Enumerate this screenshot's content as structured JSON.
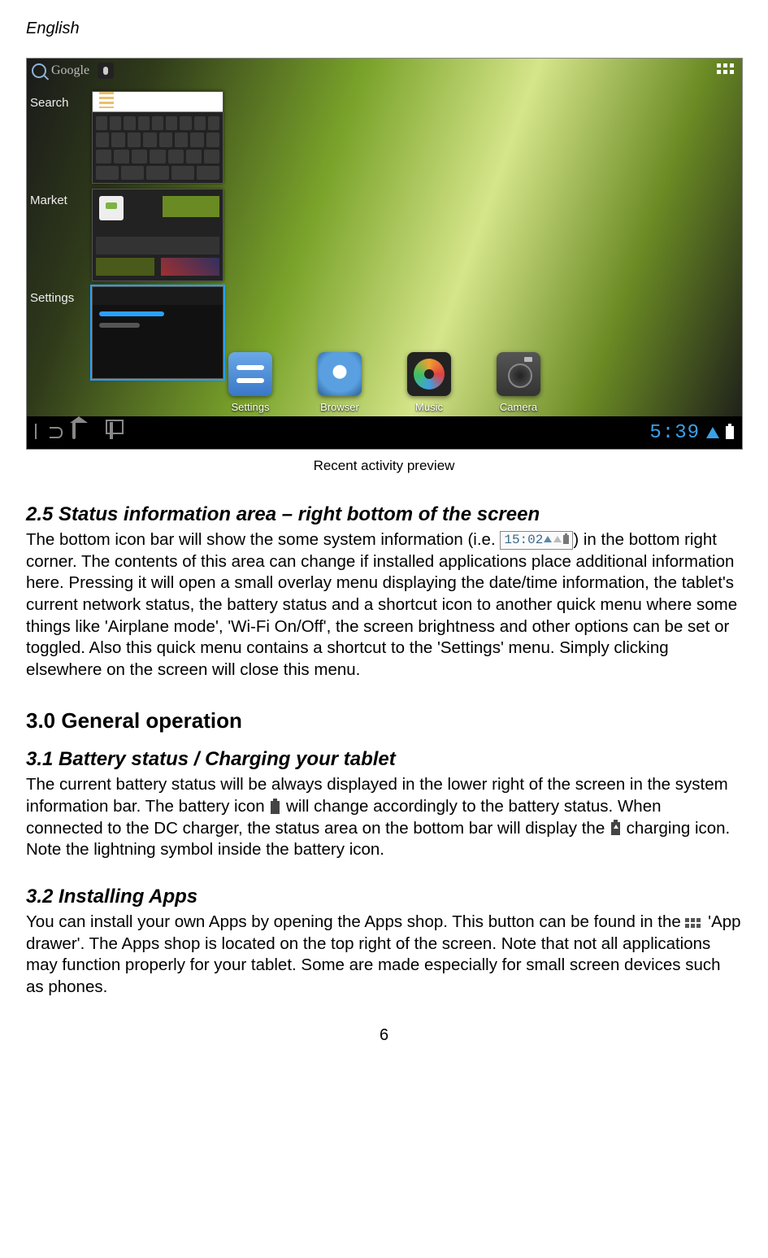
{
  "header": {
    "language": "English"
  },
  "screenshot": {
    "search_hint": "Google",
    "recent_items": [
      "Search",
      "Market",
      "Settings"
    ],
    "dock": [
      "Settings",
      "Browser",
      "Music",
      "Camera"
    ],
    "clock": "5:39"
  },
  "caption": "Recent activity preview",
  "sec25": {
    "title": "2.5 Status information area – right bottom of the screen",
    "p_a": "The bottom icon bar will show the some system information (i.e. ",
    "status_time": "15:02",
    "p_b": ") in the bottom right corner. The contents of this area can change if installed applications place additional information here. Pressing it will open a small overlay menu displaying the date/time information, the tablet's current network status, the battery status and a shortcut icon to another quick menu where some things like 'Airplane mode', 'Wi-Fi On/Off', the screen brightness and other options can be set or toggled. Also this quick menu contains a shortcut to the 'Settings' menu. Simply clicking elsewhere on the screen will close this menu."
  },
  "sec30": {
    "title": "3.0 General operation"
  },
  "sec31": {
    "title": "3.1 Battery status / Charging your tablet",
    "p_a": "The current battery status will be always displayed in the lower right of the screen in the system information bar. The battery icon ",
    "p_b": " will change accordingly to the battery status. When connected to the DC charger, the status area on the bottom bar will display the ",
    "p_c": " charging icon. Note the lightning symbol inside the battery icon."
  },
  "sec32": {
    "title": "3.2 Installing Apps",
    "p_a": "You can install your own Apps by opening the Apps shop. This button can be found in the ",
    "p_b": " 'App drawer'. The Apps shop is located on the top right of the screen. Note that not all applications may function properly for your tablet. Some are made especially for small screen devices such as phones."
  },
  "page_number": "6"
}
